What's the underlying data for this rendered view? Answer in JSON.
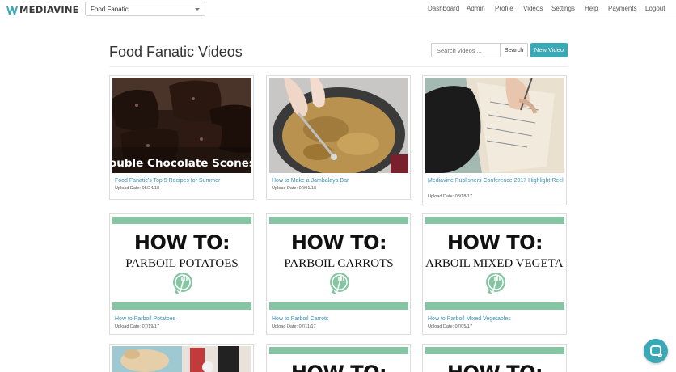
{
  "brand": {
    "logo_text": "MEDIAVINE",
    "accent_color": "#3aa9b5",
    "link_color": "#3a8fb1",
    "band_color": "#85c5a3"
  },
  "site_selector": {
    "value": "Food Fanatic"
  },
  "nav": {
    "items": [
      "Dashboard",
      "Admin",
      "Profile",
      "Videos",
      "Settings",
      "Help",
      "Payments",
      "Logout"
    ]
  },
  "page": {
    "title": "Food Fanatic Videos",
    "search_placeholder": "Search videos ...",
    "search_label": "Search",
    "new_video_label": "New Video"
  },
  "videos": [
    {
      "title": "Food Fanatic's Top 5 Recipes for Summer",
      "date": "Upload Date: 05/24/18",
      "thumb": "chocolate-scones",
      "overlay": "ouble Chocolate Scones"
    },
    {
      "title": "How to Make a Jambalaya Bar",
      "date": "Upload Date: 02/01/18",
      "thumb": "jambalaya-pot"
    },
    {
      "title": "Mediavine Publishers Conference 2017 Highlight Reel",
      "date": "Upload Date: 08/18/17",
      "thumb": "writing-hand"
    },
    {
      "title": "How to Parboil Potatoes",
      "date": "Upload Date: 07/19/17",
      "thumb": "how-to-card",
      "h1": "HOW TO:",
      "h2": "PARBOIL POTATOES"
    },
    {
      "title": "How to Parboil Carrots",
      "date": "Upload Date: 07/11/17",
      "thumb": "how-to-card",
      "h1": "HOW TO:",
      "h2": "PARBOIL CARROTS"
    },
    {
      "title": "How to Parboil Mixed Vegetables",
      "date": "Upload Date: 07/05/17",
      "thumb": "how-to-card",
      "h1": "HOW TO:",
      "h2": "ARBOIL MIXED VEGETABLE"
    }
  ],
  "partial_row": {
    "h1_a": "HOW TO:",
    "h1_b": "HOW TO:"
  },
  "chat": {
    "icon": "chat-bubble-icon"
  }
}
